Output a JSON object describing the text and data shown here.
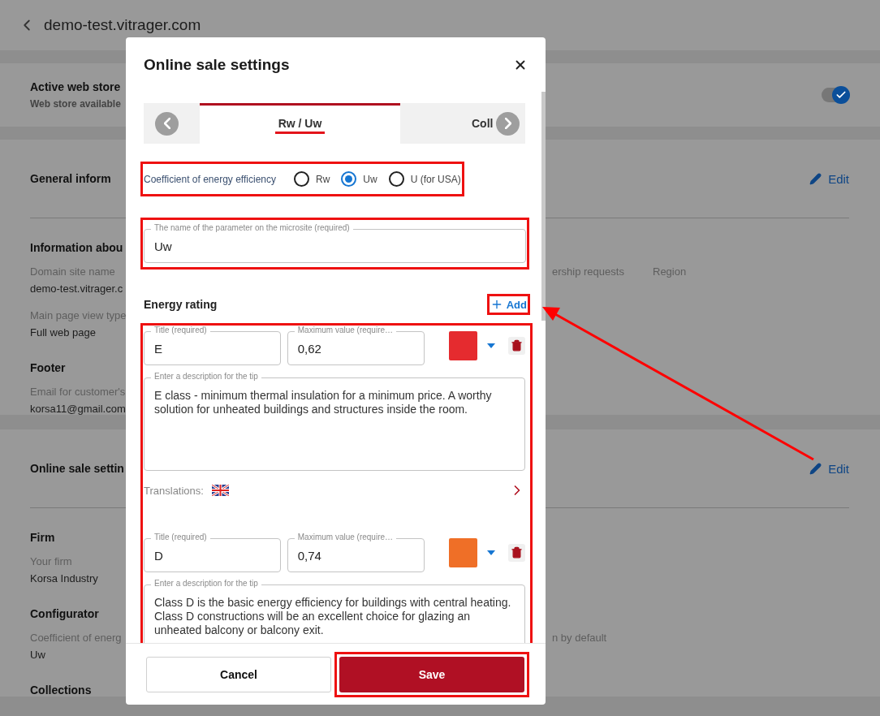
{
  "header": {
    "title": "demo-test.vitrager.com"
  },
  "web_store": {
    "title": "Active web store",
    "subtitle": "Web store available",
    "on": true
  },
  "cards": [
    {
      "title": "General inform",
      "edit": "Edit",
      "sections": [
        {
          "title": "Information abou",
          "rows": [
            {
              "cells": [
                {
                  "label": "Domain site name",
                  "value": "demo-test.vitrager.c"
                },
                {
                  "label": "ership requests"
                },
                {
                  "label": "Region"
                }
              ]
            },
            {
              "cells": [
                {
                  "label": "Main page view type",
                  "value": "Full web page"
                }
              ]
            }
          ]
        },
        {
          "title": "Footer",
          "rows": [
            {
              "cells": [
                {
                  "label": "Email for customer's",
                  "value": "korsa11@gmail.com"
                }
              ]
            }
          ]
        }
      ]
    },
    {
      "title": "Online sale settin",
      "edit": "Edit",
      "sections": [
        {
          "title": "Firm",
          "rows": [
            {
              "cells": [
                {
                  "label": "Your firm",
                  "value": "Korsa Industry"
                }
              ]
            }
          ]
        },
        {
          "title": "Configurator",
          "rows": [
            {
              "cells": [
                {
                  "label": "Coefficient of energ",
                  "value": "Uw"
                },
                {
                  "label": "n by default"
                }
              ]
            }
          ]
        },
        {
          "title": "Collections"
        }
      ]
    }
  ],
  "modal": {
    "title": "Online sale settings",
    "tabs": [
      {
        "label": "Rw / Uw",
        "selected": true,
        "highlight": true
      },
      {
        "label": "Coll",
        "selected": false,
        "highlight": false
      }
    ],
    "coefficient": {
      "label": "Coefficient of energy efficiency",
      "highlight": true,
      "options": [
        {
          "label": "Rw",
          "selected": false
        },
        {
          "label": "Uw",
          "selected": true
        },
        {
          "label": "U (for USA)",
          "selected": false
        }
      ]
    },
    "parameter_name": {
      "label": "The name of the parameter on the microsite (required)",
      "value": "Uw",
      "highlight": true
    },
    "energy_rating": {
      "title": "Energy rating",
      "add": "Add",
      "add_highlight": true,
      "list_highlight": true,
      "items": [
        {
          "title_label": "Title (required)",
          "title": "E",
          "max_label": "Maximum value (require…",
          "max": "0,62",
          "color": "#e52b2f",
          "description_label": "Enter a description for the tip",
          "description": "E class - minimum thermal insulation for a minimum price. A worthy solution for unheated buildings and structures inside the room.",
          "translations_label": "Translations:"
        },
        {
          "title_label": "Title (required)",
          "title": "D",
          "max_label": "Maximum value (require…",
          "max": "0,74",
          "color": "#ef6f27",
          "description_label": "Enter a description for the tip",
          "description": "Class D is the basic energy efficiency for buildings with central heating. Class D constructions will be an excellent choice for glazing an unheated balcony or balcony exit."
        }
      ]
    },
    "cancel": "Cancel",
    "save": "Save",
    "save_highlight": true
  }
}
